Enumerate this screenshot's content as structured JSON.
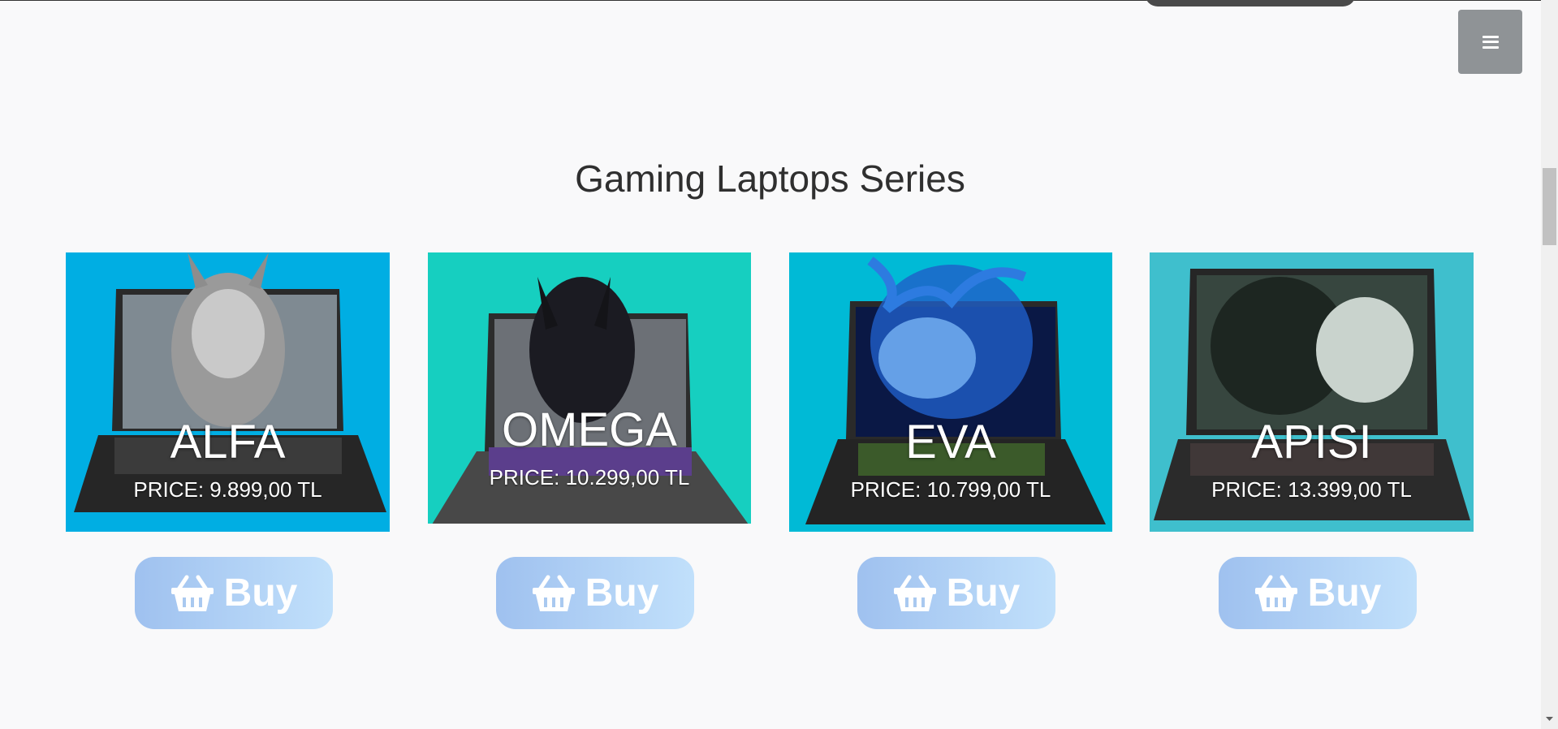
{
  "section": {
    "title": "Gaming Laptops Series"
  },
  "menu": {
    "icon": "hamburger-menu-icon"
  },
  "products": [
    {
      "name": "ALFA",
      "price": "PRICE: 9.899,00 TL",
      "bg": "#00aee3",
      "buy_label": "Buy"
    },
    {
      "name": "OMEGA",
      "price": "PRICE: 10.299,00 TL",
      "bg": "#16cfc0",
      "buy_label": "Buy"
    },
    {
      "name": "EVA",
      "price": "PRICE: 10.799,00 TL",
      "bg": "#00bad6",
      "buy_label": "Buy"
    },
    {
      "name": "APISI",
      "price": "PRICE: 13.399,00 TL",
      "bg": "#3fbfcd",
      "buy_label": "Buy"
    }
  ],
  "buy_icon": "basket-icon",
  "scrollbar": {
    "down_icon": "scroll-down-arrow-icon"
  }
}
